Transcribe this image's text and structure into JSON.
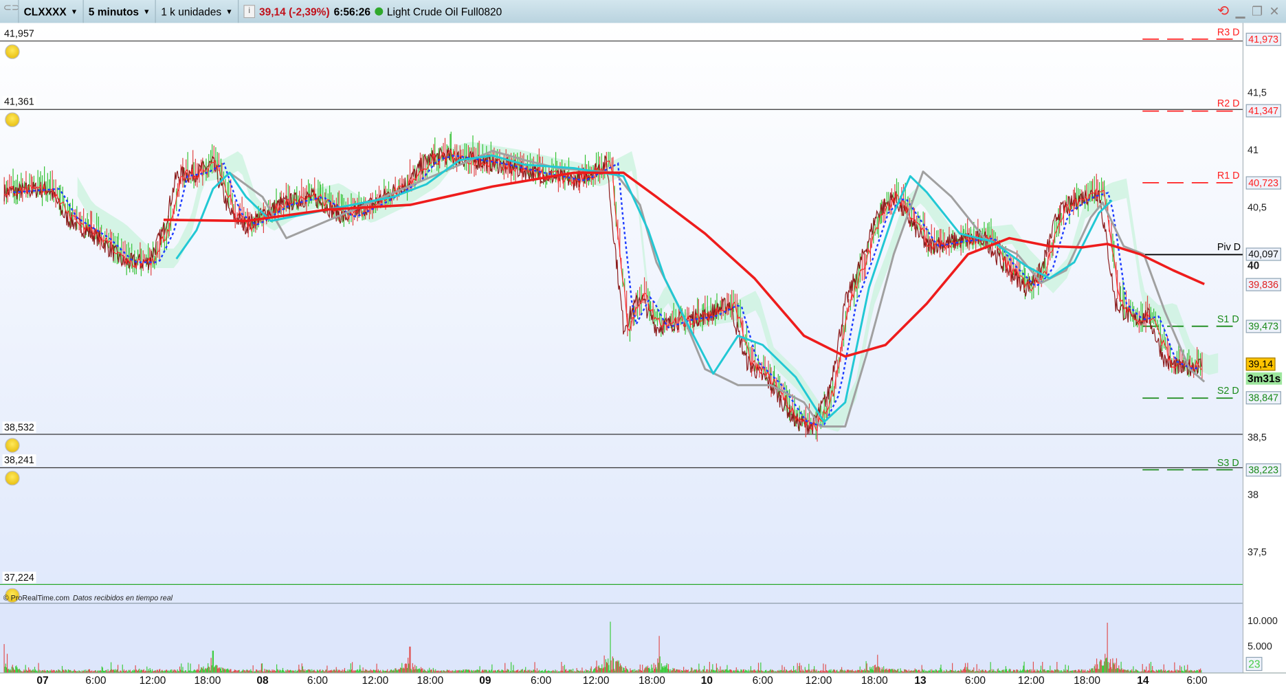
{
  "toolbar": {
    "symbol": "CLXXXX",
    "timeframe": "5 minutos",
    "units": "1 k unidades",
    "quote": "39,14 (-2,39%)",
    "time": "6:56:26",
    "instrument": "Light Crude Oil Full0820"
  },
  "levels_left": [
    {
      "label": "41,957",
      "price": 41.957
    },
    {
      "label": "41,361",
      "price": 41.361
    },
    {
      "label": "38,532",
      "price": 38.532
    },
    {
      "label": "38,241",
      "price": 38.241
    },
    {
      "label": "37,224",
      "price": 37.224
    }
  ],
  "pivots": [
    {
      "name": "R3 D",
      "value": "41,973",
      "price": 41.973,
      "color": "#ff2020"
    },
    {
      "name": "R2 D",
      "value": "41,347",
      "price": 41.347,
      "color": "#ff2020"
    },
    {
      "name": "R1 D",
      "value": "40,723",
      "price": 40.723,
      "color": "#ff2020"
    },
    {
      "name": "Piv D",
      "value": "40,097",
      "price": 40.097,
      "color": "#000000"
    },
    {
      "name": "S1 D",
      "value": "39,473",
      "price": 39.473,
      "color": "#1a8a1a"
    },
    {
      "name": "S2 D",
      "value": "38,847",
      "price": 38.847,
      "color": "#1a8a1a"
    },
    {
      "name": "S3 D",
      "value": "38,223",
      "price": 38.223,
      "color": "#1a8a1a"
    }
  ],
  "axis": {
    "ticks": [
      {
        "label": "41,5",
        "price": 41.5
      },
      {
        "label": "41",
        "price": 41
      },
      {
        "label": "40,5",
        "price": 40.5
      },
      {
        "label": "40",
        "price": 40,
        "bold": true
      },
      {
        "label": "38,5",
        "price": 38.5
      },
      {
        "label": "38",
        "price": 38
      },
      {
        "label": "37,5",
        "price": 37.5
      }
    ],
    "ma_value": "39,836",
    "last_price": "39,14",
    "countdown": "3m31s"
  },
  "volume_axis": {
    "ticks": [
      {
        "label": "10.000",
        "value": 10000
      },
      {
        "label": "5.000",
        "value": 5000
      }
    ],
    "last": "23"
  },
  "footer": {
    "copyright": "© ProRealTime.com",
    "status": "Datos recibidos en tiempo real"
  },
  "chart_data": {
    "type": "line",
    "title": "CLXXXX 5 minutos",
    "x_unit": "hours from 07 00:00 (session time)",
    "ylim": [
      37.1,
      42.1
    ],
    "x_ticks": [
      {
        "label": "07",
        "t": 0,
        "bold": true
      },
      {
        "label": "6:00",
        "t": 5.8
      },
      {
        "label": "12:00",
        "t": 12
      },
      {
        "label": "18:00",
        "t": 18
      },
      {
        "label": "08",
        "t": 24,
        "bold": true
      },
      {
        "label": "6:00",
        "t": 30
      },
      {
        "label": "12:00",
        "t": 36.3
      },
      {
        "label": "18:00",
        "t": 42.3
      },
      {
        "label": "09",
        "t": 48.3,
        "bold": true
      },
      {
        "label": "6:00",
        "t": 54.4
      },
      {
        "label": "12:00",
        "t": 60.4
      },
      {
        "label": "18:00",
        "t": 66.5
      },
      {
        "label": "10",
        "t": 72.5,
        "bold": true
      },
      {
        "label": "6:00",
        "t": 78.6
      },
      {
        "label": "12:00",
        "t": 84.7
      },
      {
        "label": "18:00",
        "t": 90.8
      },
      {
        "label": "13",
        "t": 95.8,
        "bold": true
      },
      {
        "label": "6:00",
        "t": 101.8
      },
      {
        "label": "12:00",
        "t": 107.9
      },
      {
        "label": "18:00",
        "t": 114
      },
      {
        "label": "14",
        "t": 120.1,
        "bold": true
      },
      {
        "label": "6:00",
        "t": 126
      }
    ],
    "price": {
      "t": [
        -4.2,
        0.7,
        2.5,
        6.1,
        8.8,
        11.5,
        13.2,
        14.6,
        16.8,
        18.6,
        20.4,
        22.2,
        25.8,
        29.4,
        32.9,
        36.5,
        40.1,
        41.9,
        43.7,
        49.1,
        53.5,
        58,
        61.6,
        62,
        63.4,
        65.2,
        67,
        69.7,
        72.3,
        75,
        76.8,
        79.5,
        82.2,
        84,
        85.8,
        87.6,
        89.3,
        91.1,
        92.9,
        94.7,
        96.5,
        99.2,
        102.8,
        104.6,
        107.3,
        109,
        110.8,
        113.5,
        115.3,
        116.2,
        117.1,
        118.9,
        120.7,
        122.5,
        124.3,
        126.5
      ],
      "v": [
        40.64,
        40.67,
        40.42,
        40.24,
        40.03,
        40.03,
        40.31,
        40.78,
        40.81,
        40.89,
        40.46,
        40.35,
        40.53,
        40.6,
        40.42,
        40.56,
        40.74,
        40.92,
        40.96,
        40.89,
        40.81,
        40.74,
        40.89,
        40.53,
        39.46,
        39.74,
        39.46,
        39.53,
        39.56,
        39.67,
        39.17,
        38.96,
        38.64,
        38.6,
        38.89,
        39.67,
        40.03,
        40.46,
        40.6,
        40.39,
        40.17,
        40.21,
        40.24,
        40.03,
        39.81,
        39.96,
        40.46,
        40.6,
        40.64,
        40.17,
        39.67,
        39.53,
        39.56,
        39.17,
        39.1,
        39.14
      ]
    },
    "ma_red": {
      "t": [
        13.2,
        22.2,
        31.2,
        40.1,
        49.1,
        58,
        63.4,
        67,
        72.3,
        77.7,
        83.1,
        87.6,
        92,
        96.5,
        101,
        105.5,
        109.9,
        113.5,
        116.2,
        119.8,
        123.4,
        126.8
      ],
      "v": [
        40.4,
        40.39,
        40.49,
        40.53,
        40.69,
        40.81,
        40.81,
        40.6,
        40.28,
        39.89,
        39.39,
        39.21,
        39.31,
        39.67,
        40.1,
        40.24,
        40.17,
        40.16,
        40.19,
        40.1,
        39.96,
        39.84
      ]
    },
    "ma_cyan": {
      "t": [
        14.6,
        16.8,
        18.6,
        20.4,
        22.2,
        24.9,
        31.2,
        38.3,
        41.9,
        45.5,
        49.1,
        52.6,
        58,
        63.4,
        66.1,
        67.9,
        70.6,
        73.2,
        75.9,
        78.6,
        82.2,
        85.3,
        87.6,
        90.2,
        92.9,
        94.7,
        96.5,
        100.1,
        103.7,
        107.3,
        109.9,
        112.6,
        115.3,
        116.7
      ],
      "v": [
        40.06,
        40.31,
        40.67,
        40.81,
        40.6,
        40.39,
        40.49,
        40.6,
        40.71,
        40.92,
        40.96,
        40.88,
        40.85,
        40.78,
        40.31,
        39.89,
        39.46,
        39.06,
        39.39,
        39.31,
        39.03,
        38.64,
        38.81,
        39.81,
        40.46,
        40.78,
        40.64,
        40.28,
        40.21,
        40.0,
        39.89,
        40.03,
        40.46,
        40.57
      ]
    },
    "ma_gray": {
      "t": [
        20.4,
        24,
        26.6,
        49.1,
        52.6,
        56.2,
        62.5,
        65.2,
        67,
        69.7,
        72.3,
        75.9,
        79.5,
        83.1,
        84.9,
        87.6,
        90.2,
        92.9,
        96.1,
        99.2,
        102.8,
        106.4,
        109,
        111.7,
        114.4,
        115.7,
        118,
        120.2,
        122.5,
        125.2,
        126.8
      ],
      "v": [
        40.81,
        40.6,
        40.24,
        41.0,
        40.92,
        40.85,
        40.81,
        40.53,
        40.03,
        39.6,
        39.1,
        38.96,
        38.96,
        38.81,
        38.6,
        38.6,
        39.3,
        40.1,
        40.82,
        40.6,
        40.24,
        40.1,
        39.85,
        39.96,
        40.42,
        40.55,
        40.17,
        40.1,
        39.6,
        39.1,
        38.99
      ]
    },
    "volume_spikes": [
      {
        "t": -4.2,
        "v": 5600
      },
      {
        "t": 18.6,
        "v": 4300
      },
      {
        "t": 40.1,
        "v": 5100
      },
      {
        "t": 62,
        "v": 10000
      },
      {
        "t": 67.3,
        "v": 7200
      },
      {
        "t": 91.1,
        "v": 3500
      },
      {
        "t": 116.2,
        "v": 9800
      }
    ]
  }
}
